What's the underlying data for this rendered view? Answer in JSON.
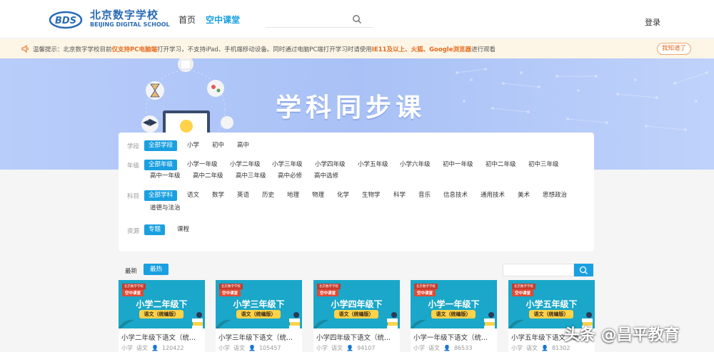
{
  "header": {
    "logo_cn": "北京数字学校",
    "logo_en": "BEIJING DIGITAL SCHOOL",
    "nav": [
      "首页",
      "空中课堂"
    ],
    "login": "登录"
  },
  "notice": {
    "prefix": "温馨提示：北京数字学校目前",
    "hl1": "仅支持PC电脑端",
    "mid": "打开学习，不支持iPad、手机端移动设备。同时通过电脑PC端打开学习时请使用",
    "hl2": "IE11及以上、火狐、Google浏览器",
    "suffix": "进行观看",
    "button": "我知道了"
  },
  "banner": {
    "title": "学科同步课"
  },
  "filters": {
    "stage": {
      "label": "学段",
      "options": [
        "全部学段",
        "小学",
        "初中",
        "高中"
      ]
    },
    "grade": {
      "label": "年级",
      "options": [
        "全部年级",
        "小学一年级",
        "小学二年级",
        "小学三年级",
        "小学四年级",
        "小学五年级",
        "小学六年级",
        "初中一年级",
        "初中二年级",
        "初中三年级",
        "高中一年级",
        "高中二年级",
        "高中三年级",
        "高中必修",
        "高中选修"
      ]
    },
    "subject": {
      "label": "科目",
      "options": [
        "全部学科",
        "语文",
        "数学",
        "英语",
        "历史",
        "地理",
        "物理",
        "化学",
        "生物学",
        "科学",
        "音乐",
        "信息技术",
        "通用技术",
        "美术",
        "思想政治",
        "道德与法治"
      ]
    },
    "resource": {
      "label": "资源",
      "options": [
        "专题",
        "课程"
      ]
    }
  },
  "sort": {
    "newest": "最新",
    "hottest": "最热"
  },
  "cards": [
    {
      "school": "北京数字学校",
      "kt": "空中课堂",
      "big": "小学二年级下",
      "sub": "语文（统编版）",
      "title": "小学二年级下语文（统...",
      "stage": "小学",
      "subject": "语文",
      "views": "120422"
    },
    {
      "school": "北京数字学校",
      "kt": "空中课堂",
      "big": "小学三年级下",
      "sub": "语文（统编版）",
      "title": "小学三年级下语文（统...",
      "stage": "小学",
      "subject": "语文",
      "views": "105457"
    },
    {
      "school": "北京数字学校",
      "kt": "空中课堂",
      "big": "小学四年级下",
      "sub": "语文（统编版）",
      "title": "小学四年级下语文（统...",
      "stage": "小学",
      "subject": "语文",
      "views": "94107"
    },
    {
      "school": "北京数字学校",
      "kt": "空中课堂",
      "big": "小学一年级下",
      "sub": "语文（统编版）",
      "title": "小学一年级下语文（统...",
      "stage": "小学",
      "subject": "语文",
      "views": "86533"
    },
    {
      "school": "北京数字学校",
      "kt": "空中课堂",
      "big": "小学五年级下",
      "sub": "语文（统编版）",
      "title": "小学五年级下语文（统...",
      "stage": "小学",
      "subject": "语文",
      "views": "81302"
    }
  ],
  "watermark": "头条 @昌平教育",
  "colors": {
    "accent": "#1aa0e0",
    "notice_highlight": "#e56a1e",
    "banner": "#aec5f7",
    "thumb": "#1aa7c9"
  }
}
